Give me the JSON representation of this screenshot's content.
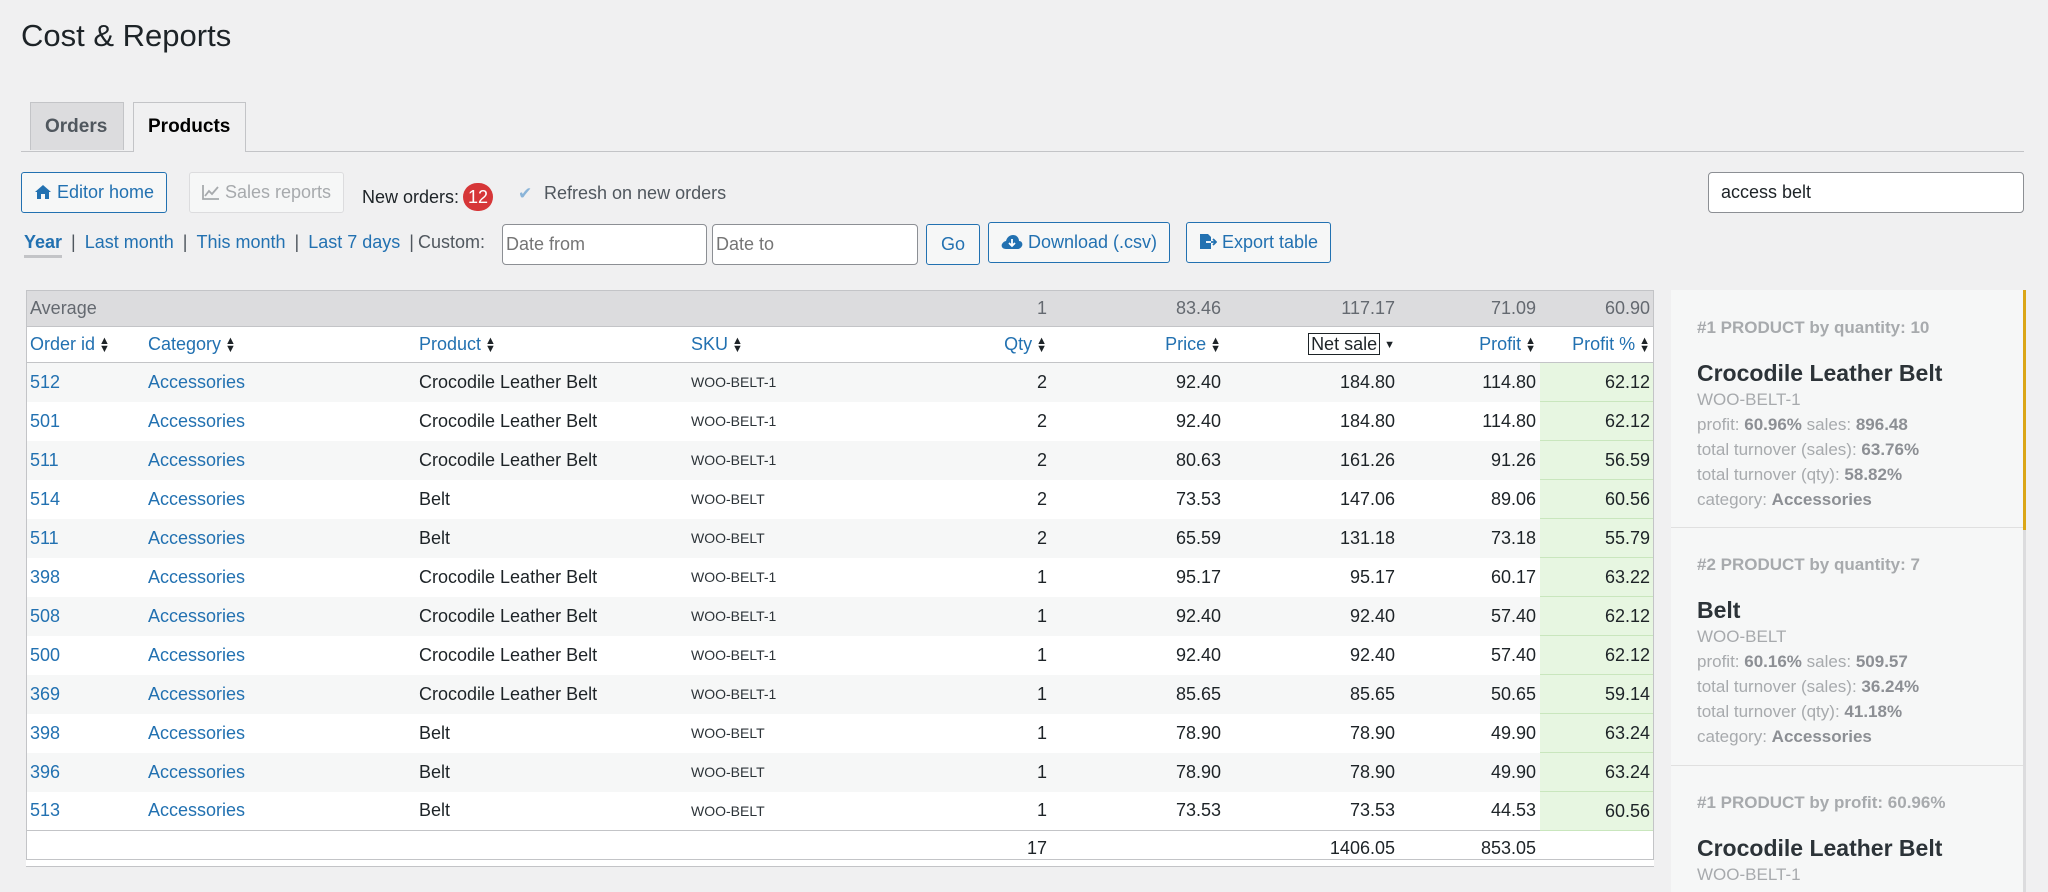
{
  "page": {
    "title": "Cost & Reports"
  },
  "tabs": [
    {
      "label": "Orders",
      "active": false
    },
    {
      "label": "Products",
      "active": true
    }
  ],
  "toolbar": {
    "editor_home": "Editor home",
    "sales_reports": "Sales reports",
    "new_orders_label": "New orders:",
    "new_orders_count": "12",
    "refresh_label": "Refresh on new orders",
    "search_value": "access belt"
  },
  "periods": {
    "year": "Year",
    "last_month": "Last month",
    "this_month": "This month",
    "last_7_days": "Last 7 days",
    "custom": "Custom:",
    "sep": "|",
    "date_from_placeholder": "Date from",
    "date_to_placeholder": "Date to",
    "go": "Go",
    "download": "Download (.csv)",
    "export": "Export table"
  },
  "table": {
    "average": {
      "label": "Average",
      "qty": "1",
      "price": "83.46",
      "net_sale": "117.17",
      "profit": "71.09",
      "profit_pct": "60.90"
    },
    "columns": {
      "order_id": "Order id",
      "category": "Category",
      "product": "Product",
      "sku": "SKU",
      "qty": "Qty",
      "price": "Price",
      "net_sale": "Net sale",
      "profit": "Profit",
      "profit_pct": "Profit %"
    },
    "rows": [
      {
        "order_id": "512",
        "category": "Accessories",
        "product": "Crocodile Leather Belt",
        "sku": "WOO-BELT-1",
        "qty": "2",
        "price": "92.40",
        "net_sale": "184.80",
        "profit": "114.80",
        "profit_pct": "62.12"
      },
      {
        "order_id": "501",
        "category": "Accessories",
        "product": "Crocodile Leather Belt",
        "sku": "WOO-BELT-1",
        "qty": "2",
        "price": "92.40",
        "net_sale": "184.80",
        "profit": "114.80",
        "profit_pct": "62.12"
      },
      {
        "order_id": "511",
        "category": "Accessories",
        "product": "Crocodile Leather Belt",
        "sku": "WOO-BELT-1",
        "qty": "2",
        "price": "80.63",
        "net_sale": "161.26",
        "profit": "91.26",
        "profit_pct": "56.59"
      },
      {
        "order_id": "514",
        "category": "Accessories",
        "product": "Belt",
        "sku": "WOO-BELT",
        "qty": "2",
        "price": "73.53",
        "net_sale": "147.06",
        "profit": "89.06",
        "profit_pct": "60.56"
      },
      {
        "order_id": "511",
        "category": "Accessories",
        "product": "Belt",
        "sku": "WOO-BELT",
        "qty": "2",
        "price": "65.59",
        "net_sale": "131.18",
        "profit": "73.18",
        "profit_pct": "55.79"
      },
      {
        "order_id": "398",
        "category": "Accessories",
        "product": "Crocodile Leather Belt",
        "sku": "WOO-BELT-1",
        "qty": "1",
        "price": "95.17",
        "net_sale": "95.17",
        "profit": "60.17",
        "profit_pct": "63.22"
      },
      {
        "order_id": "508",
        "category": "Accessories",
        "product": "Crocodile Leather Belt",
        "sku": "WOO-BELT-1",
        "qty": "1",
        "price": "92.40",
        "net_sale": "92.40",
        "profit": "57.40",
        "profit_pct": "62.12"
      },
      {
        "order_id": "500",
        "category": "Accessories",
        "product": "Crocodile Leather Belt",
        "sku": "WOO-BELT-1",
        "qty": "1",
        "price": "92.40",
        "net_sale": "92.40",
        "profit": "57.40",
        "profit_pct": "62.12"
      },
      {
        "order_id": "369",
        "category": "Accessories",
        "product": "Crocodile Leather Belt",
        "sku": "WOO-BELT-1",
        "qty": "1",
        "price": "85.65",
        "net_sale": "85.65",
        "profit": "50.65",
        "profit_pct": "59.14"
      },
      {
        "order_id": "398",
        "category": "Accessories",
        "product": "Belt",
        "sku": "WOO-BELT",
        "qty": "1",
        "price": "78.90",
        "net_sale": "78.90",
        "profit": "49.90",
        "profit_pct": "63.24"
      },
      {
        "order_id": "396",
        "category": "Accessories",
        "product": "Belt",
        "sku": "WOO-BELT",
        "qty": "1",
        "price": "78.90",
        "net_sale": "78.90",
        "profit": "49.90",
        "profit_pct": "63.24"
      },
      {
        "order_id": "513",
        "category": "Accessories",
        "product": "Belt",
        "sku": "WOO-BELT",
        "qty": "1",
        "price": "73.53",
        "net_sale": "73.53",
        "profit": "44.53",
        "profit_pct": "60.56"
      }
    ],
    "totals": {
      "qty": "17",
      "net_sale": "1406.05",
      "profit": "853.05"
    }
  },
  "panel": {
    "labels": {
      "profit": "profit:",
      "sales": "sales:",
      "turnover_sales": "total turnover (sales):",
      "turnover_qty": "total turnover (qty):",
      "category": "category:"
    },
    "cards": [
      {
        "title": "#1 PRODUCT by quantity: 10",
        "name": "Crocodile Leather Belt",
        "sku": "WOO-BELT-1",
        "profit": "60.96%",
        "sales": "896.48",
        "turnover_sales": "63.76%",
        "turnover_qty": "58.82%",
        "category": "Accessories"
      },
      {
        "title": "#2 PRODUCT by quantity: 7",
        "name": "Belt",
        "sku": "WOO-BELT",
        "profit": "60.16%",
        "sales": "509.57",
        "turnover_sales": "36.24%",
        "turnover_qty": "41.18%",
        "category": "Accessories"
      },
      {
        "title": "#1 PRODUCT by profit: 60.96%",
        "name": "Crocodile Leather Belt",
        "sku": "WOO-BELT-1"
      }
    ]
  },
  "colors": {
    "accent": "#2271b1",
    "badge": "#d63638",
    "profit_cell": "#e7f6e1",
    "panel_highlight": "#dba617"
  }
}
